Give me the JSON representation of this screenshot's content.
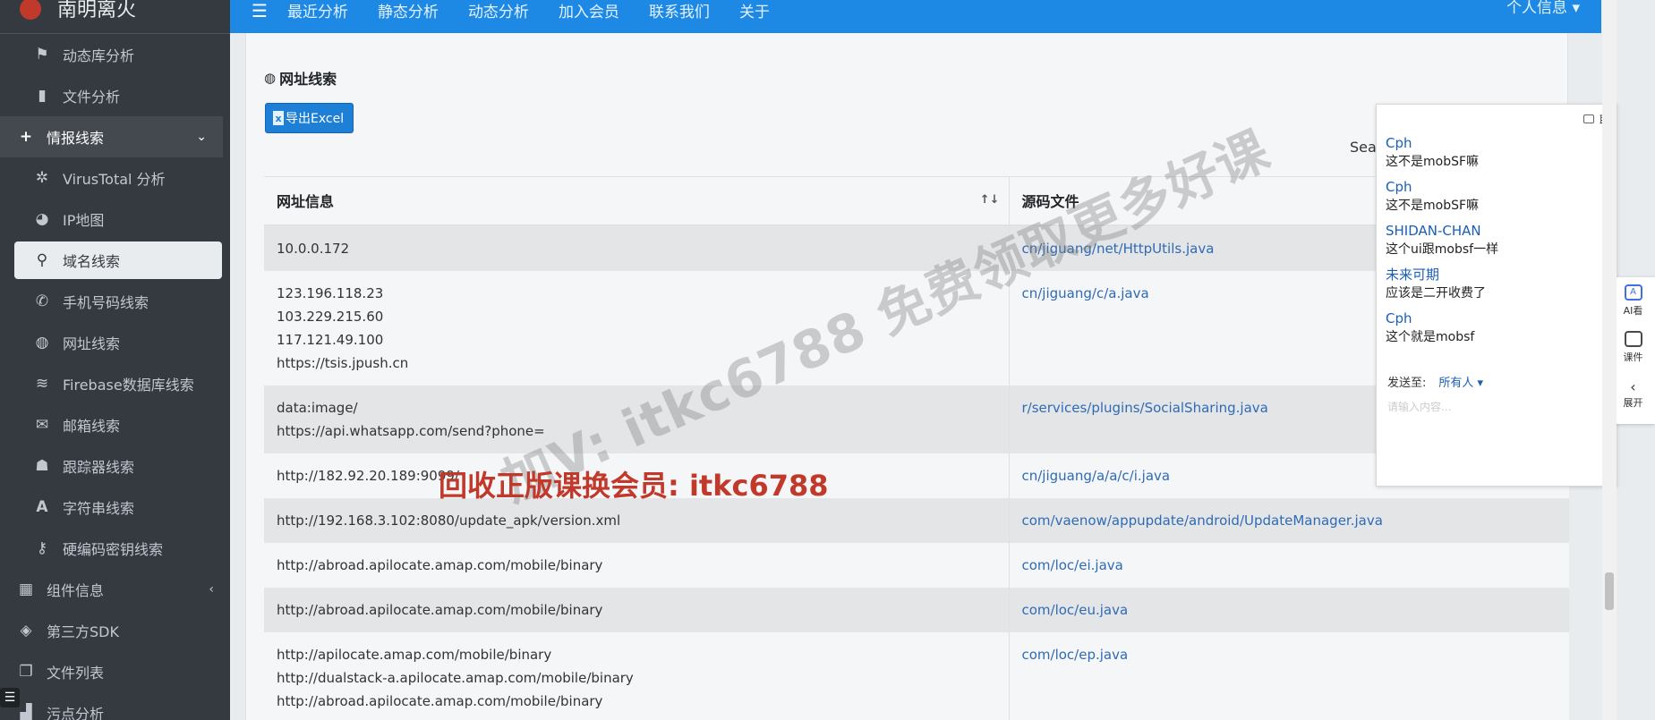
{
  "brand": {
    "name": "南明离火"
  },
  "topbar": {
    "menu_icon": "hamburger-icon",
    "links": [
      "最近分析",
      "静态分析",
      "动态分析",
      "加入会员",
      "联系我们",
      "关于"
    ],
    "profile": "个人信息 ▾"
  },
  "sidebar": {
    "items": [
      {
        "label": "动态库分析",
        "icon": "flag-icon"
      },
      {
        "label": "文件分析",
        "icon": "file-icon"
      },
      {
        "label": "情报线索",
        "icon": "plus-icon"
      },
      {
        "label": "VirusTotal 分析",
        "icon": "bug-icon"
      },
      {
        "label": "IP地图",
        "icon": "globe-icon"
      },
      {
        "label": "域名线索",
        "icon": "search-icon"
      },
      {
        "label": "手机号码线索",
        "icon": "phone-icon"
      },
      {
        "label": "网址线索",
        "icon": "globe-icon"
      },
      {
        "label": "Firebase数据库线索",
        "icon": "database-icon"
      },
      {
        "label": "邮箱线索",
        "icon": "envelope-icon"
      },
      {
        "label": "跟踪器线索",
        "icon": "user-secret-icon"
      },
      {
        "label": "字符串线索",
        "icon": "font-icon"
      },
      {
        "label": "硬编码密钥线索",
        "icon": "key-icon"
      },
      {
        "label": "组件信息",
        "icon": "grid-icon"
      },
      {
        "label": "第三方SDK",
        "icon": "layers-icon"
      },
      {
        "label": "文件列表",
        "icon": "copy-icon"
      },
      {
        "label": "污点分析",
        "icon": "chart-icon"
      }
    ]
  },
  "main": {
    "section_title": "网址线索",
    "export_button": "导出Excel",
    "search_label": "Sear",
    "columns": [
      "网址信息",
      "源码文件"
    ],
    "rows": [
      {
        "urls": [
          "10.0.0.172"
        ],
        "file": "cn/jiguang/net/HttpUtils.java"
      },
      {
        "urls": [
          "123.196.118.23",
          "103.229.215.60",
          "117.121.49.100",
          "https://tsis.jpush.cn"
        ],
        "file": "cn/jiguang/c/a.java"
      },
      {
        "urls": [
          "data:image/",
          "https://api.whatsapp.com/send?phone="
        ],
        "file": "r/services/plugins/SocialSharing.java"
      },
      {
        "urls": [
          "http://182.92.20.189:9099/"
        ],
        "file": "cn/jiguang/a/a/c/i.java"
      },
      {
        "urls": [
          "http://192.168.3.102:8080/update_apk/version.xml"
        ],
        "file": "com/vaenow/appupdate/android/UpdateManager.java"
      },
      {
        "urls": [
          "http://abroad.apilocate.amap.com/mobile/binary"
        ],
        "file": "com/loc/ei.java"
      },
      {
        "urls": [
          "http://abroad.apilocate.amap.com/mobile/binary"
        ],
        "file": "com/loc/eu.java"
      },
      {
        "urls": [
          "http://apilocate.amap.com/mobile/binary",
          "http://dualstack-a.apilocate.amap.com/mobile/binary",
          "http://abroad.apilocate.amap.com/mobile/binary"
        ],
        "file": "com/loc/ep.java"
      }
    ]
  },
  "chat": {
    "header": "聊",
    "messages": [
      {
        "who": "Cph",
        "text": "这不是mobSF嘛"
      },
      {
        "who": "Cph",
        "text": "这不是mobSF嘛"
      },
      {
        "who": "SHIDAN-CHAN",
        "text": "这个ui跟mobsf一样"
      },
      {
        "who": "未来可期",
        "text": "应该是二开收费了"
      },
      {
        "who": "Cph",
        "text": "这个就是mobsf"
      }
    ],
    "send_to_label": "发送至:",
    "send_to_target": "所有人 ▾",
    "input_placeholder": "请输入内容..."
  },
  "tools": [
    {
      "label": "AI看",
      "icon": "ai-icon"
    },
    {
      "label": "课件",
      "icon": "courseware-icon"
    },
    {
      "label": "展开",
      "icon": "chevron-left-icon"
    }
  ],
  "watermark": {
    "big": "加V: itkc6788 免费领取更多好课",
    "red": "回收正版课换会员: itkc6788"
  }
}
